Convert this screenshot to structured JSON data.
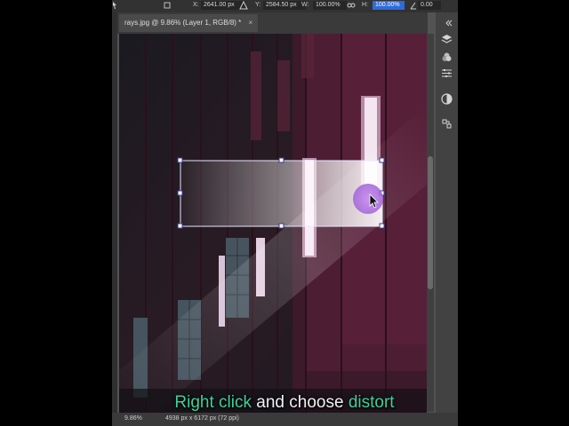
{
  "options_bar": {
    "x_label": "X:",
    "x_value": "2641.00 px",
    "y_label": "Y:",
    "y_value": "2584.50 px",
    "w_label": "W:",
    "w_value": "100.00%",
    "h_label": "H:",
    "h_value": "100.00%",
    "angle_value": "0.00"
  },
  "document": {
    "tab_title": "rays.jpg @ 9.86% (Layer 1, RGB/8) *",
    "close_glyph": "×"
  },
  "status_bar": {
    "zoom": "9.86%",
    "doc_info": "4938 px x 6172 px (72 ppi)"
  },
  "caption": {
    "part1": "Right click",
    "part2": " and choose ",
    "part3": "distort",
    "highlight_color": "#3ed19a",
    "plain_color": "#f2f2f2"
  },
  "icons": [
    "move-tool-icon",
    "link-icon",
    "collapse-arrows-icon",
    "layers-icon",
    "channels-icon",
    "adjustments-icon",
    "properties-icon",
    "paths-icon"
  ]
}
